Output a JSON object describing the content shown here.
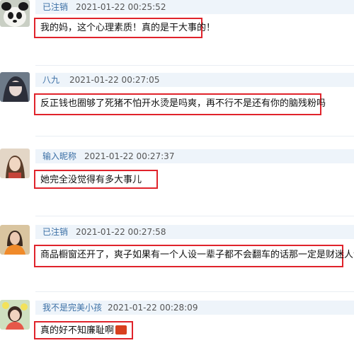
{
  "comments": [
    {
      "username": "已注销",
      "timestamp": "2021-01-22 00:25:52",
      "text": "我的妈，这个心理素质！真的是干大事的！",
      "avatar_icon": "panda-avatar-icon"
    },
    {
      "username": "八九",
      "timestamp": "2021-01-22 00:27:05",
      "text": "反正钱也圈够了死猪不怕开水烫是吗爽，再不行不是还有你的脑残粉吗",
      "avatar_icon": "girl-portrait-avatar-icon"
    },
    {
      "username": "输入昵称",
      "timestamp": "2021-01-22 00:27:37",
      "text": "她完全没觉得有多大事儿",
      "avatar_icon": "woman-portrait-avatar-icon"
    },
    {
      "username": "已注销",
      "timestamp": "2021-01-22 00:27:58",
      "text": "商品橱窗还开了，爽子如果有一个人设一辈子都不会翻车的话那一定是财迷人设",
      "avatar_icon": "woman-orange-avatar-icon"
    },
    {
      "username": "我不是完美小孩",
      "timestamp": "2021-01-22 00:28:09",
      "text": "真的好不知廉耻啊",
      "avatar_icon": "girl-flowers-avatar-icon",
      "emoji_icon": "angry-emoji-icon"
    }
  ],
  "colors": {
    "highlight_border": "#e0232b",
    "username": "#3b6fa5",
    "meta_background": "#eef4fa"
  }
}
